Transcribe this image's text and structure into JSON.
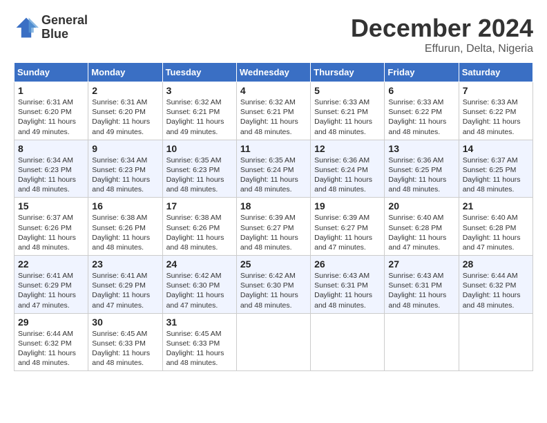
{
  "logo": {
    "line1": "General",
    "line2": "Blue"
  },
  "title": "December 2024",
  "subtitle": "Effurun, Delta, Nigeria",
  "headers": [
    "Sunday",
    "Monday",
    "Tuesday",
    "Wednesday",
    "Thursday",
    "Friday",
    "Saturday"
  ],
  "weeks": [
    [
      {
        "day": "1",
        "sunrise": "6:31 AM",
        "sunset": "6:20 PM",
        "daylight": "11 hours and 49 minutes."
      },
      {
        "day": "2",
        "sunrise": "6:31 AM",
        "sunset": "6:20 PM",
        "daylight": "11 hours and 49 minutes."
      },
      {
        "day": "3",
        "sunrise": "6:32 AM",
        "sunset": "6:21 PM",
        "daylight": "11 hours and 49 minutes."
      },
      {
        "day": "4",
        "sunrise": "6:32 AM",
        "sunset": "6:21 PM",
        "daylight": "11 hours and 48 minutes."
      },
      {
        "day": "5",
        "sunrise": "6:33 AM",
        "sunset": "6:21 PM",
        "daylight": "11 hours and 48 minutes."
      },
      {
        "day": "6",
        "sunrise": "6:33 AM",
        "sunset": "6:22 PM",
        "daylight": "11 hours and 48 minutes."
      },
      {
        "day": "7",
        "sunrise": "6:33 AM",
        "sunset": "6:22 PM",
        "daylight": "11 hours and 48 minutes."
      }
    ],
    [
      {
        "day": "8",
        "sunrise": "6:34 AM",
        "sunset": "6:23 PM",
        "daylight": "11 hours and 48 minutes."
      },
      {
        "day": "9",
        "sunrise": "6:34 AM",
        "sunset": "6:23 PM",
        "daylight": "11 hours and 48 minutes."
      },
      {
        "day": "10",
        "sunrise": "6:35 AM",
        "sunset": "6:23 PM",
        "daylight": "11 hours and 48 minutes."
      },
      {
        "day": "11",
        "sunrise": "6:35 AM",
        "sunset": "6:24 PM",
        "daylight": "11 hours and 48 minutes."
      },
      {
        "day": "12",
        "sunrise": "6:36 AM",
        "sunset": "6:24 PM",
        "daylight": "11 hours and 48 minutes."
      },
      {
        "day": "13",
        "sunrise": "6:36 AM",
        "sunset": "6:25 PM",
        "daylight": "11 hours and 48 minutes."
      },
      {
        "day": "14",
        "sunrise": "6:37 AM",
        "sunset": "6:25 PM",
        "daylight": "11 hours and 48 minutes."
      }
    ],
    [
      {
        "day": "15",
        "sunrise": "6:37 AM",
        "sunset": "6:26 PM",
        "daylight": "11 hours and 48 minutes."
      },
      {
        "day": "16",
        "sunrise": "6:38 AM",
        "sunset": "6:26 PM",
        "daylight": "11 hours and 48 minutes."
      },
      {
        "day": "17",
        "sunrise": "6:38 AM",
        "sunset": "6:26 PM",
        "daylight": "11 hours and 48 minutes."
      },
      {
        "day": "18",
        "sunrise": "6:39 AM",
        "sunset": "6:27 PM",
        "daylight": "11 hours and 48 minutes."
      },
      {
        "day": "19",
        "sunrise": "6:39 AM",
        "sunset": "6:27 PM",
        "daylight": "11 hours and 47 minutes."
      },
      {
        "day": "20",
        "sunrise": "6:40 AM",
        "sunset": "6:28 PM",
        "daylight": "11 hours and 47 minutes."
      },
      {
        "day": "21",
        "sunrise": "6:40 AM",
        "sunset": "6:28 PM",
        "daylight": "11 hours and 47 minutes."
      }
    ],
    [
      {
        "day": "22",
        "sunrise": "6:41 AM",
        "sunset": "6:29 PM",
        "daylight": "11 hours and 47 minutes."
      },
      {
        "day": "23",
        "sunrise": "6:41 AM",
        "sunset": "6:29 PM",
        "daylight": "11 hours and 47 minutes."
      },
      {
        "day": "24",
        "sunrise": "6:42 AM",
        "sunset": "6:30 PM",
        "daylight": "11 hours and 47 minutes."
      },
      {
        "day": "25",
        "sunrise": "6:42 AM",
        "sunset": "6:30 PM",
        "daylight": "11 hours and 48 minutes."
      },
      {
        "day": "26",
        "sunrise": "6:43 AM",
        "sunset": "6:31 PM",
        "daylight": "11 hours and 48 minutes."
      },
      {
        "day": "27",
        "sunrise": "6:43 AM",
        "sunset": "6:31 PM",
        "daylight": "11 hours and 48 minutes."
      },
      {
        "day": "28",
        "sunrise": "6:44 AM",
        "sunset": "6:32 PM",
        "daylight": "11 hours and 48 minutes."
      }
    ],
    [
      {
        "day": "29",
        "sunrise": "6:44 AM",
        "sunset": "6:32 PM",
        "daylight": "11 hours and 48 minutes."
      },
      {
        "day": "30",
        "sunrise": "6:45 AM",
        "sunset": "6:33 PM",
        "daylight": "11 hours and 48 minutes."
      },
      {
        "day": "31",
        "sunrise": "6:45 AM",
        "sunset": "6:33 PM",
        "daylight": "11 hours and 48 minutes."
      },
      null,
      null,
      null,
      null
    ]
  ]
}
